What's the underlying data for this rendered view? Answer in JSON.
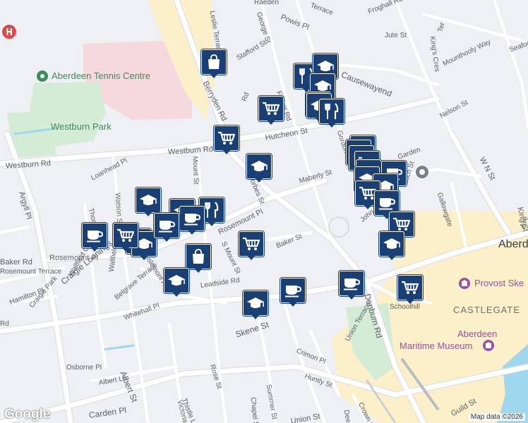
{
  "map": {
    "colors": {
      "land": "#eef0f3",
      "park": "#d4ecd6",
      "hospital_area": "#f6d9dc",
      "commercial": "#fbf0c9",
      "water": "#9fd7ee",
      "road": "#ffffff",
      "road_border": "#d8dbe0",
      "marker": "#1a3f75",
      "label": "#5b5f66"
    },
    "street_labels": [
      {
        "name": "Westburn Rd"
      },
      {
        "name": "Westburn Rd"
      },
      {
        "name": "Hutcheon St"
      },
      {
        "name": "Berryden Rd"
      },
      {
        "name": "Leslie Terrace"
      },
      {
        "name": "George St"
      },
      {
        "name": "Powis Pl"
      },
      {
        "name": "Stafford St"
      },
      {
        "name": "Fraser Rd"
      },
      {
        "name": "Causewayend"
      },
      {
        "name": "Jute St"
      },
      {
        "name": "Froghall Rd"
      },
      {
        "name": "King's Cres"
      },
      {
        "name": "Mounthooly Way"
      },
      {
        "name": "Seaforth"
      },
      {
        "name": "Nelson St"
      },
      {
        "name": "W N St"
      },
      {
        "name": "Gallowgate"
      },
      {
        "name": "King St"
      },
      {
        "name": "Maberly St"
      },
      {
        "name": "Forbes St"
      },
      {
        "name": "Mount St"
      },
      {
        "name": "Loanhead Pl"
      },
      {
        "name": "Watson St"
      },
      {
        "name": "Rosemount Pl"
      },
      {
        "name": "Rosemount Pl"
      },
      {
        "name": "Baker St"
      },
      {
        "name": "S Mount St"
      },
      {
        "name": "Argyll Pl"
      },
      {
        "name": "Thomson St"
      },
      {
        "name": "Baker Rd"
      },
      {
        "name": "Craigie Loanings"
      },
      {
        "name": "Craigie Park"
      },
      {
        "name": "Wallfield Cres"
      },
      {
        "name": "Wallfield Pl"
      },
      {
        "name": "Hamilton Pl"
      },
      {
        "name": "Belgrave Terrace"
      },
      {
        "name": "Esslemont Ave"
      },
      {
        "name": "Leadside Rd"
      },
      {
        "name": "Whitehall Pl"
      },
      {
        "name": "Skene St"
      },
      {
        "name": "Denburn Rd"
      },
      {
        "name": "Schoolhill"
      },
      {
        "name": "Union Terrace"
      },
      {
        "name": "Crimon Pl"
      },
      {
        "name": "Huntly St"
      },
      {
        "name": "Summer St"
      },
      {
        "name": "Chapel St"
      },
      {
        "name": "Rose St"
      },
      {
        "name": "Thistle Ln"
      },
      {
        "name": "Victoria St"
      },
      {
        "name": "Albert St"
      },
      {
        "name": "Albert Ln"
      },
      {
        "name": "Osborne Pl"
      },
      {
        "name": "Carden Pl"
      },
      {
        "name": "Guild St"
      },
      {
        "name": "Crown St"
      },
      {
        "name": "Dee St"
      },
      {
        "name": "Union St"
      },
      {
        "name": "Rosemount Terrace"
      },
      {
        "name": "John St"
      },
      {
        "name": "Loch St"
      },
      {
        "name": "Terrace"
      },
      {
        "name": "Rd"
      },
      {
        "name": "Ter"
      },
      {
        "name": "Gordon"
      },
      {
        "name": "Garden"
      },
      {
        "name": "Ave"
      },
      {
        "name": "Rd"
      },
      {
        "name": "Raeden"
      }
    ],
    "poi_labels": [
      {
        "name": "Aberdeen Tennis Centre",
        "color": "#3c8d5a",
        "icon": "park-pin-icon"
      },
      {
        "name": "Westburn Park",
        "color": "#3c8d5a"
      },
      {
        "name": "Provost Skene's House",
        "display": "Provost Ske",
        "color": "#9a4fa0",
        "icon": "museum-pin-icon"
      },
      {
        "name": "Aberdeen Maritime Museum",
        "line1": "Aberdeen",
        "line2": "Maritime Museum",
        "color": "#9a4fa0",
        "icon": "museum-pin-icon"
      },
      {
        "name": "CASTLEGATE",
        "color": "#6b6f76"
      },
      {
        "name": "Aberdeen",
        "display": "Aberde",
        "color": "#3a3d42"
      }
    ],
    "markers": [
      {
        "type": "shopping-bag"
      },
      {
        "type": "cart"
      },
      {
        "type": "restaurant"
      },
      {
        "type": "school"
      },
      {
        "type": "school"
      },
      {
        "type": "cart"
      },
      {
        "type": "cart"
      },
      {
        "type": "school"
      },
      {
        "type": "restaurant"
      },
      {
        "type": "cart"
      },
      {
        "type": "school"
      },
      {
        "type": "school"
      },
      {
        "type": "cart"
      },
      {
        "type": "school"
      },
      {
        "type": "school"
      },
      {
        "type": "cafe"
      },
      {
        "type": "school"
      },
      {
        "type": "cart"
      },
      {
        "type": "cafe"
      },
      {
        "type": "cart"
      },
      {
        "type": "school"
      },
      {
        "type": "school"
      },
      {
        "type": "cafe"
      },
      {
        "type": "cart"
      },
      {
        "type": "school"
      },
      {
        "type": "cafe"
      },
      {
        "type": "school"
      },
      {
        "type": "school"
      },
      {
        "type": "restaurant"
      },
      {
        "type": "shopping-bag"
      },
      {
        "type": "school"
      },
      {
        "type": "school"
      },
      {
        "type": "cafe"
      },
      {
        "type": "cafe"
      },
      {
        "type": "school"
      },
      {
        "type": "cafe"
      },
      {
        "type": "cart"
      },
      {
        "type": "cart"
      },
      {
        "type": "school"
      }
    ],
    "hospital_icon": "hospital-icon",
    "footer": {
      "attribution": "Map data ©2026",
      "logo_text": "Google"
    }
  }
}
